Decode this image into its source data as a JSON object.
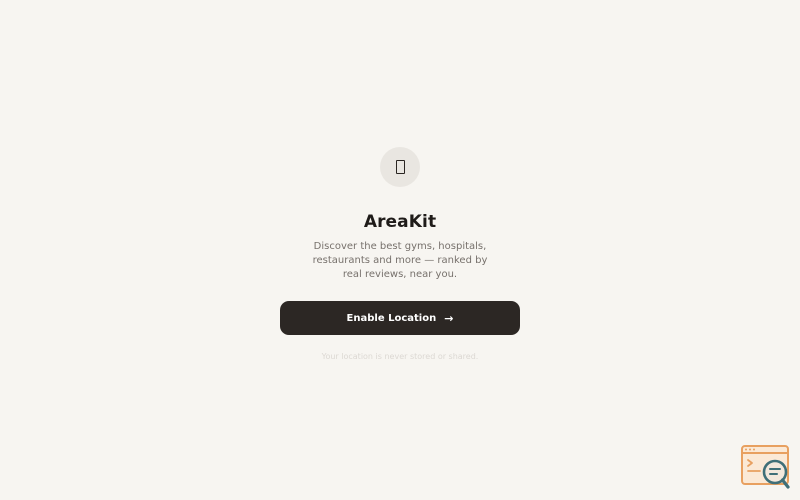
{
  "app": {
    "icon": "location-pin-icon",
    "title": "AreaKit",
    "description": "Discover the best gyms, hospitals, restaurants and more — ranked by real reviews, near you."
  },
  "actions": {
    "enable_location_label": "Enable Location",
    "enable_location_arrow": "→"
  },
  "privacy_note": "Your location is never stored or shared.",
  "corner_badge": {
    "icon": "browser-search-icon"
  },
  "colors": {
    "background": "#f7f5f1",
    "button": "#2c2724",
    "title": "#1f1b19",
    "muted_text": "#77716c",
    "badge_orange": "#e8a060",
    "badge_teal": "#3f6f78"
  }
}
